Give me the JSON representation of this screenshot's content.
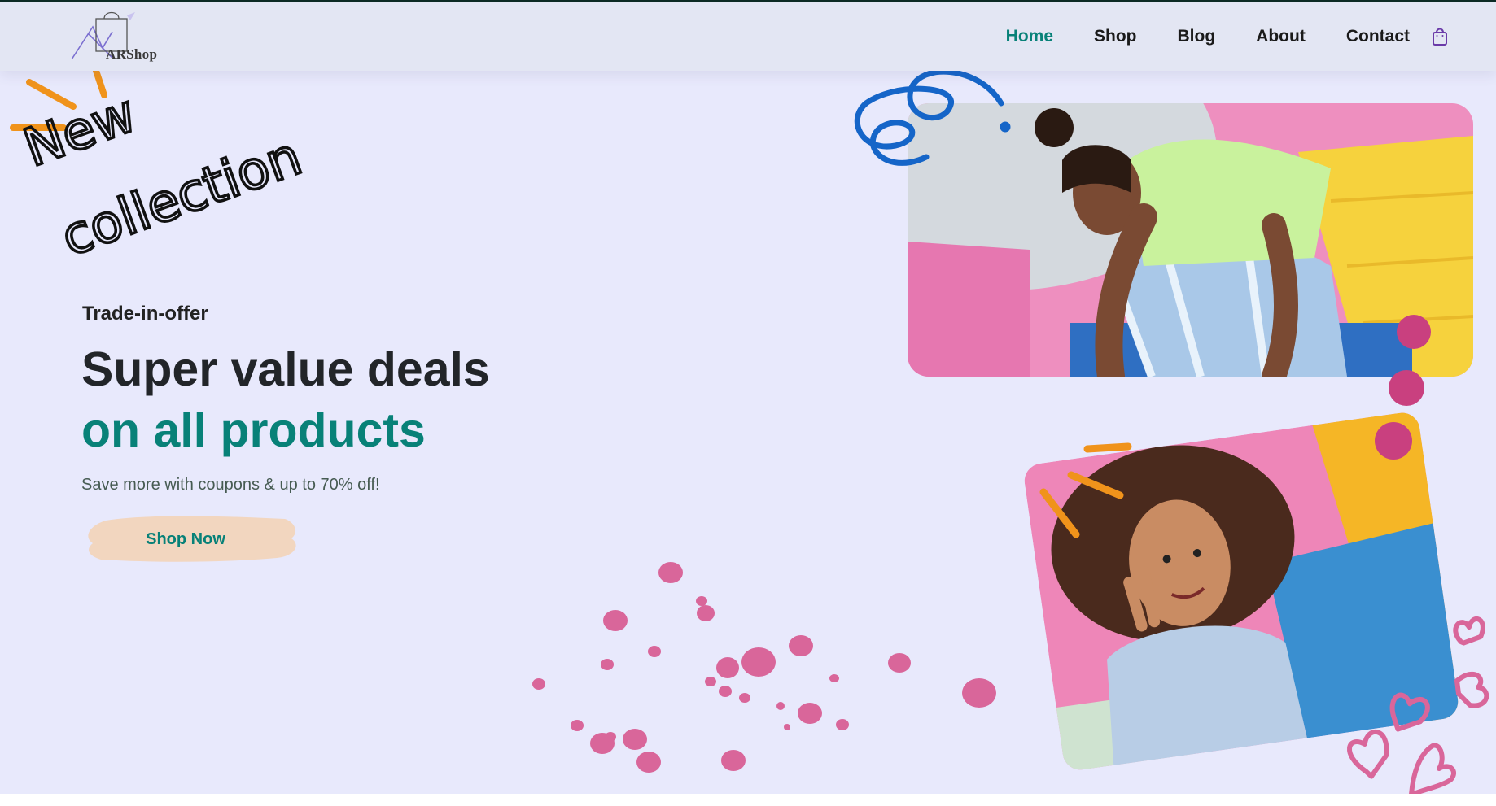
{
  "brand": {
    "logo_text": "ARShop"
  },
  "nav": {
    "items": [
      {
        "label": "Home",
        "active": true
      },
      {
        "label": "Shop",
        "active": false
      },
      {
        "label": "Blog",
        "active": false
      },
      {
        "label": "About",
        "active": false
      },
      {
        "label": "Contact",
        "active": false
      }
    ],
    "cart_icon": "shopping-bag-icon"
  },
  "hero": {
    "handwritten": [
      "New",
      "collection"
    ],
    "subtitle": "Trade-in-offer",
    "title_line1": "Super value deals",
    "title_line2": "on all products",
    "description": "Save more with coupons & up to 70% off!",
    "cta_label": "Shop Now"
  },
  "colors": {
    "accent": "#088178",
    "hero_bg": "#e8e9fc",
    "header_bg": "#e3e6f3",
    "button_bg": "#f2d6bf",
    "dots": "#d9669a",
    "orange": "#f0931b",
    "blue_swirl": "#1565c8"
  }
}
